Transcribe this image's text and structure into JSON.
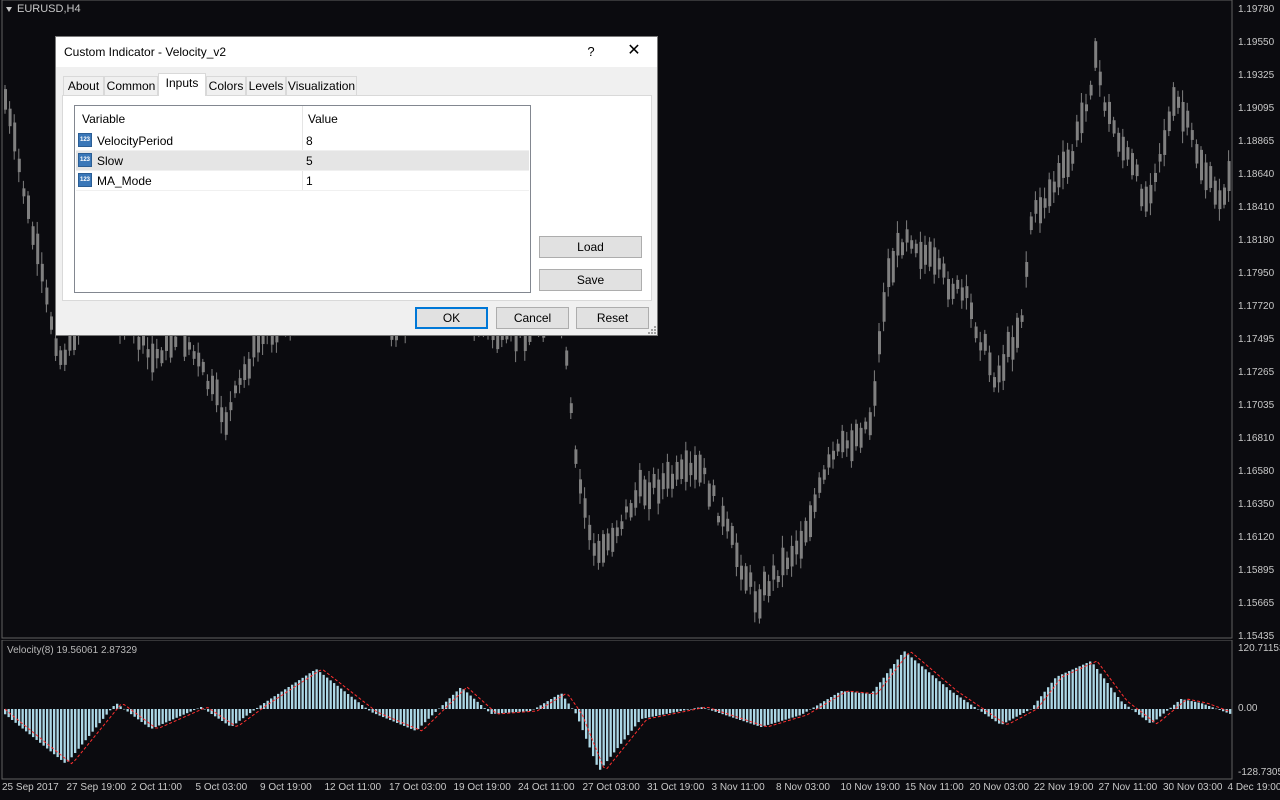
{
  "chart": {
    "symbol": "EURUSD,H4",
    "price_labels": [
      "1.19780",
      "1.19550",
      "1.19325",
      "1.19095",
      "1.18865",
      "1.18640",
      "1.18410",
      "1.18180",
      "1.17950",
      "1.17720",
      "1.17495",
      "1.17265",
      "1.17035",
      "1.16810",
      "1.16580",
      "1.16350",
      "1.16120",
      "1.15895",
      "1.15665",
      "1.15435"
    ],
    "time_labels": [
      "25 Sep 2017",
      "27 Sep 19:00",
      "2 Oct 11:00",
      "5 Oct 03:00",
      "9 Oct 19:00",
      "12 Oct 11:00",
      "17 Oct 03:00",
      "19 Oct 19:00",
      "24 Oct 11:00",
      "27 Oct 03:00",
      "31 Oct 19:00",
      "3 Nov 11:00",
      "8 Nov 03:00",
      "10 Nov 19:00",
      "15 Nov 11:00",
      "20 Nov 03:00",
      "22 Nov 19:00",
      "27 Nov 11:00",
      "30 Nov 03:00",
      "4 Dec 19:00"
    ],
    "colors": {
      "background": "#0b0b0f",
      "candles": "#808080",
      "histogram": "#add8e6",
      "signal": "#ff3030",
      "text": "#c8c8c8"
    }
  },
  "indicator": {
    "label": "Velocity(8) 19.56061 2.87329",
    "scale_labels": [
      "120.71153",
      "0.00",
      "-128.7305"
    ]
  },
  "dialog": {
    "title": "Custom Indicator - Velocity_v2",
    "help_label": "?",
    "close_label": "✕",
    "tabs": [
      {
        "label": "About"
      },
      {
        "label": "Common"
      },
      {
        "label": "Inputs"
      },
      {
        "label": "Colors"
      },
      {
        "label": "Levels"
      },
      {
        "label": "Visualization"
      }
    ],
    "active_tab": "Inputs",
    "table": {
      "headers": [
        "Variable",
        "Value"
      ],
      "rows": [
        {
          "name": "VelocityPeriod",
          "value": "8",
          "icon": "123-icon"
        },
        {
          "name": "Slow",
          "value": "5",
          "icon": "123-icon"
        },
        {
          "name": "MA_Mode",
          "value": "1",
          "icon": "123-icon"
        }
      ]
    },
    "icon_text": "123",
    "buttons": {
      "load": "Load",
      "save": "Save",
      "ok": "OK",
      "cancel": "Cancel",
      "reset": "Reset"
    }
  }
}
